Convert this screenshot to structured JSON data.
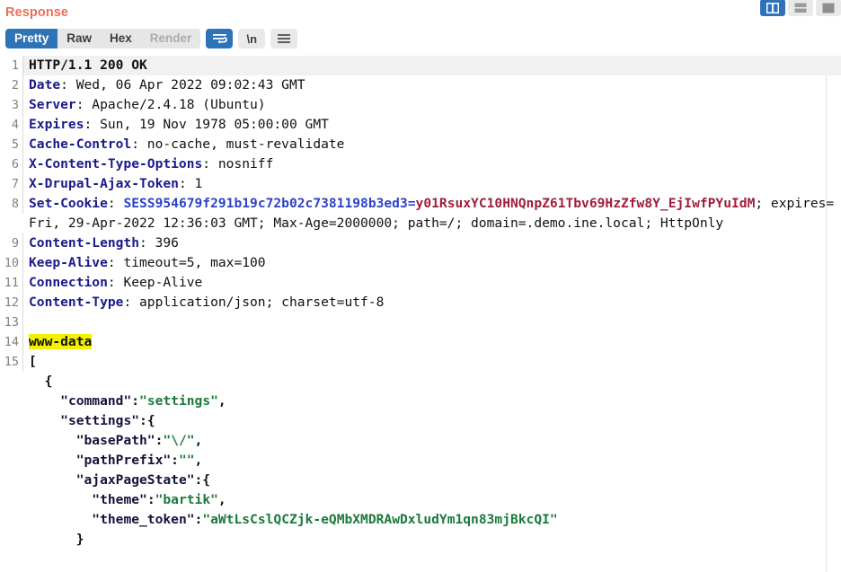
{
  "panel": {
    "title": "Response"
  },
  "layout_buttons": [
    {
      "name": "vertical-split-layout",
      "label": "Vertical split",
      "active": true
    },
    {
      "name": "horizontal-split-layout",
      "label": "Horizontal split",
      "active": false
    },
    {
      "name": "tabbed-layout",
      "label": "Tabbed view",
      "active": false
    }
  ],
  "toolbar": {
    "tabs": [
      {
        "label": "Pretty",
        "state": "active"
      },
      {
        "label": "Raw",
        "state": "normal"
      },
      {
        "label": "Hex",
        "state": "normal"
      },
      {
        "label": "Render",
        "state": "disabled"
      }
    ],
    "word_wrap_label": "Word wrap",
    "newline_label": "\\n",
    "menu_label": "Menu"
  },
  "response": {
    "status_line": "HTTP/1.1 200 OK",
    "headers": [
      {
        "line": 2,
        "name": "Date",
        "value": "Wed, 06 Apr 2022 09:02:43 GMT"
      },
      {
        "line": 3,
        "name": "Server",
        "value": "Apache/2.4.18 (Ubuntu)"
      },
      {
        "line": 4,
        "name": "Expires",
        "value": "Sun, 19 Nov 1978 05:00:00 GMT"
      },
      {
        "line": 5,
        "name": "Cache-Control",
        "value": "no-cache, must-revalidate"
      },
      {
        "line": 6,
        "name": "X-Content-Type-Options",
        "value": "nosniff"
      },
      {
        "line": 7,
        "name": "X-Drupal-Ajax-Token",
        "value": "1"
      }
    ],
    "set_cookie": {
      "line": 8,
      "header_name": "Set-Cookie",
      "cookie_name": "SESS954679f291b19c72b02c7381198b3ed3",
      "cookie_value": "y01RsuxYC10HNQnpZ61Tbv69HzZfw8Y_EjIwfPYuIdM",
      "attributes": "; expires=Fri, 29-Apr-2022 12:36:03 GMT; Max-Age=2000000; path=/; domain=.demo.ine.local; HttpOnly"
    },
    "headers_tail": [
      {
        "line": 9,
        "name": "Content-Length",
        "value": "396"
      },
      {
        "line": 10,
        "name": "Keep-Alive",
        "value": "timeout=5, max=100"
      },
      {
        "line": 11,
        "name": "Connection",
        "value": "Keep-Alive"
      },
      {
        "line": 12,
        "name": "Content-Type",
        "value": "application/json; charset=utf-8"
      }
    ],
    "blank_line": {
      "line": 13
    },
    "highlighted_line": {
      "line": 14,
      "text": "www-data",
      "highlight_color": "#f2f200"
    },
    "body_start_line": 15,
    "body_lines": [
      {
        "indent": 0,
        "tokens": [
          {
            "t": "punct",
            "v": "["
          }
        ]
      },
      {
        "indent": 1,
        "tokens": [
          {
            "t": "punct",
            "v": "{"
          }
        ]
      },
      {
        "indent": 2,
        "tokens": [
          {
            "t": "key",
            "v": "\"command\""
          },
          {
            "t": "punct",
            "v": ":"
          },
          {
            "t": "str",
            "v": "\"settings\""
          },
          {
            "t": "punct",
            "v": ","
          }
        ]
      },
      {
        "indent": 2,
        "tokens": [
          {
            "t": "key",
            "v": "\"settings\""
          },
          {
            "t": "punct",
            "v": ":{"
          }
        ]
      },
      {
        "indent": 3,
        "tokens": [
          {
            "t": "key",
            "v": "\"basePath\""
          },
          {
            "t": "punct",
            "v": ":"
          },
          {
            "t": "str",
            "v": "\"\\/\""
          },
          {
            "t": "punct",
            "v": ","
          }
        ]
      },
      {
        "indent": 3,
        "tokens": [
          {
            "t": "key",
            "v": "\"pathPrefix\""
          },
          {
            "t": "punct",
            "v": ":"
          },
          {
            "t": "str",
            "v": "\"\""
          },
          {
            "t": "punct",
            "v": ","
          }
        ]
      },
      {
        "indent": 3,
        "tokens": [
          {
            "t": "key",
            "v": "\"ajaxPageState\""
          },
          {
            "t": "punct",
            "v": ":{"
          }
        ]
      },
      {
        "indent": 4,
        "tokens": [
          {
            "t": "key",
            "v": "\"theme\""
          },
          {
            "t": "punct",
            "v": ":"
          },
          {
            "t": "str",
            "v": "\"bartik\""
          },
          {
            "t": "punct",
            "v": ","
          }
        ]
      },
      {
        "indent": 4,
        "tokens": [
          {
            "t": "key",
            "v": "\"theme_token\""
          },
          {
            "t": "punct",
            "v": ":"
          },
          {
            "t": "str",
            "v": "\"aWtLsCslQCZjk-eQMbXMDRAwDxludYm1qn83mjBkcQI\""
          }
        ]
      },
      {
        "indent": 3,
        "tokens": [
          {
            "t": "punct",
            "v": "}"
          }
        ]
      }
    ]
  }
}
